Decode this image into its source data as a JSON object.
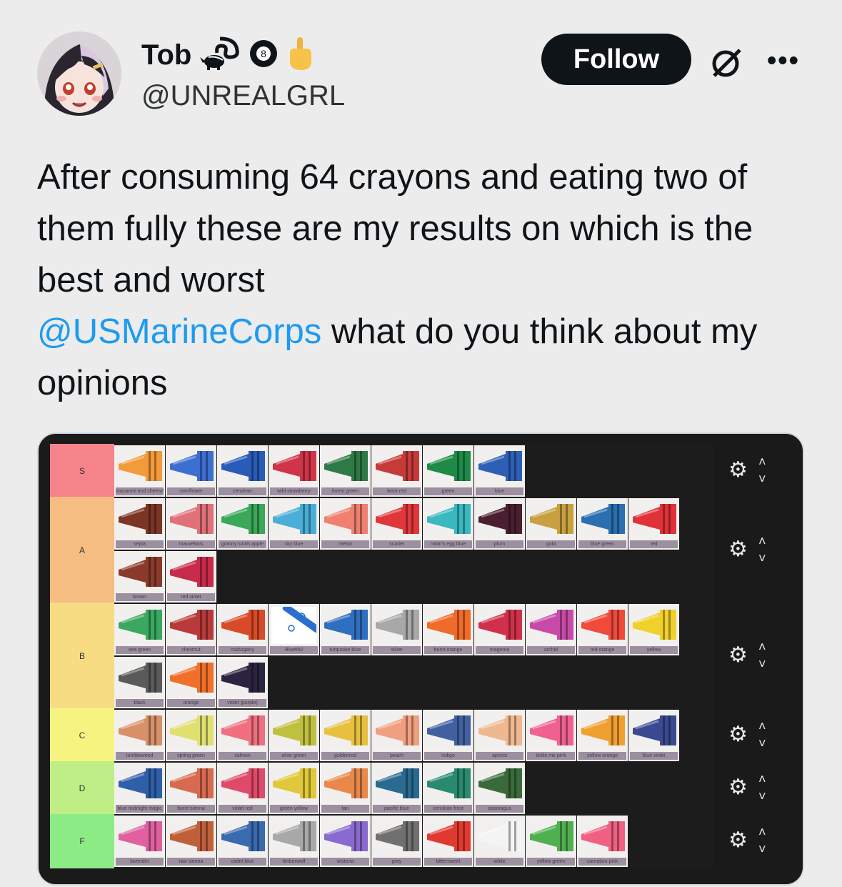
{
  "user": {
    "display_name": "Tob",
    "handle": "@UNREALGRL",
    "badge_number": "8",
    "icons": [
      "skunk-icon",
      "eight-ball-icon",
      "middle-finger-emoji"
    ]
  },
  "actions": {
    "follow_label": "Follow",
    "grok_icon": "grok-icon",
    "more_icon": "more-icon"
  },
  "tweet": {
    "line1": "After consuming 64 crayons and eating two of them fully these are my results on which is the best and worst",
    "mention": "@USMarineCorps",
    "line2": " what do you think about my opinions"
  },
  "colors": {
    "link": "#1d9bf0",
    "follow_bg": "#0f1419",
    "tier_S": "#ff7f7f",
    "tier_A": "#ffbf7f",
    "tier_B": "#ffdf7f",
    "tier_C": "#ffff7f",
    "tier_D": "#bfff7f",
    "tier_F": "#7fff7f"
  },
  "tiers": [
    {
      "label": "S",
      "color": "#f4848a",
      "crayons": [
        {
          "name": "macaroni and cheese",
          "color": "#f39a3a"
        },
        {
          "name": "cornflower",
          "color": "#3c6fd0"
        },
        {
          "name": "cerulean",
          "color": "#2a5bb8"
        },
        {
          "name": "wild strawberry",
          "color": "#d03448"
        },
        {
          "name": "forest green",
          "color": "#2e7a46"
        },
        {
          "name": "brick red",
          "color": "#c73a3a"
        },
        {
          "name": "green",
          "color": "#1f8a48"
        },
        {
          "name": "blue",
          "color": "#2f5fb5"
        }
      ]
    },
    {
      "label": "A",
      "color": "#f6bd82",
      "crayons": [
        {
          "name": "sepia",
          "color": "#7a3524"
        },
        {
          "name": "mauvelous",
          "color": "#e0707a"
        },
        {
          "name": "granny smith apple",
          "color": "#3aa858"
        },
        {
          "name": "sky blue",
          "color": "#4aaed8"
        },
        {
          "name": "melon",
          "color": "#f08070"
        },
        {
          "name": "scarlet",
          "color": "#e0383a"
        },
        {
          "name": "robin's egg blue",
          "color": "#3ab8c0"
        },
        {
          "name": "plum",
          "color": "#4a1f30"
        },
        {
          "name": "gold",
          "color": "#c8a040"
        },
        {
          "name": "blue green",
          "color": "#2a6fb0"
        },
        {
          "name": "red",
          "color": "#e03238"
        },
        {
          "name": "brown",
          "color": "#8a3a2a"
        },
        {
          "name": "red violet",
          "color": "#c82a4a"
        }
      ]
    },
    {
      "label": "B",
      "color": "#f8dc84",
      "crayons": [
        {
          "name": "sea green",
          "color": "#3aa860"
        },
        {
          "name": "chestnut",
          "color": "#b83a3a"
        },
        {
          "name": "mahogany",
          "color": "#d84a28"
        },
        {
          "name": "Bluetiful",
          "color": "#ffffff"
        },
        {
          "name": "turquoise blue",
          "color": "#2f6fc0"
        },
        {
          "name": "silver",
          "color": "#a8a8a8"
        },
        {
          "name": "burnt orange",
          "color": "#f06a2a"
        },
        {
          "name": "magenta",
          "color": "#d0304a"
        },
        {
          "name": "orchid",
          "color": "#c84aa8"
        },
        {
          "name": "red orange",
          "color": "#f04a3a"
        },
        {
          "name": "yellow",
          "color": "#f0d02a"
        },
        {
          "name": "black",
          "color": "#5a5a5a"
        },
        {
          "name": "orange",
          "color": "#f0702a"
        },
        {
          "name": "violet (purple)",
          "color": "#2a2440"
        }
      ]
    },
    {
      "label": "C",
      "color": "#f6f480",
      "crayons": [
        {
          "name": "tumbleweed",
          "color": "#d89068"
        },
        {
          "name": "spring green",
          "color": "#e0e070"
        },
        {
          "name": "salmon",
          "color": "#f07080"
        },
        {
          "name": "olive green",
          "color": "#c0c040"
        },
        {
          "name": "goldenrod",
          "color": "#e8c040"
        },
        {
          "name": "peach",
          "color": "#f0a080"
        },
        {
          "name": "indigo",
          "color": "#4060a0"
        },
        {
          "name": "apricot",
          "color": "#f0b890"
        },
        {
          "name": "tickle me pink",
          "color": "#f06090"
        },
        {
          "name": "yellow orange",
          "color": "#f0a030"
        },
        {
          "name": "blue violet",
          "color": "#3a4a90"
        }
      ]
    },
    {
      "label": "D",
      "color": "#bfed86",
      "crayons": [
        {
          "name": "blue midnight magic",
          "color": "#2f5fa8"
        },
        {
          "name": "burnt sienna",
          "color": "#d86a50"
        },
        {
          "name": "violet red",
          "color": "#e04a6a"
        },
        {
          "name": "green yellow",
          "color": "#e0c83a"
        },
        {
          "name": "tan",
          "color": "#e8884a"
        },
        {
          "name": "pacific blue",
          "color": "#2a6a90"
        },
        {
          "name": "cerulean frost",
          "color": "#2a8a70"
        },
        {
          "name": "asparagus",
          "color": "#3a6a3a"
        }
      ]
    },
    {
      "label": "F",
      "color": "#8ceb85",
      "crayons": [
        {
          "name": "lavender",
          "color": "#e060a0"
        },
        {
          "name": "raw sienna",
          "color": "#c0603a"
        },
        {
          "name": "cadet blue",
          "color": "#3a6ab0"
        },
        {
          "name": "timberwolf",
          "color": "#a8a8a8"
        },
        {
          "name": "wisteria",
          "color": "#8a6ad0"
        },
        {
          "name": "gray",
          "color": "#707070"
        },
        {
          "name": "bittersweet",
          "color": "#e03a30"
        },
        {
          "name": "white",
          "color": "#f4f4f4"
        },
        {
          "name": "yellow green",
          "color": "#50b050"
        },
        {
          "name": "carnation pink",
          "color": "#f06080"
        }
      ]
    }
  ],
  "tier_controls": {
    "gear_icon": "gear-icon",
    "up_icon": "chevron-up-icon",
    "down_icon": "chevron-down-icon"
  }
}
